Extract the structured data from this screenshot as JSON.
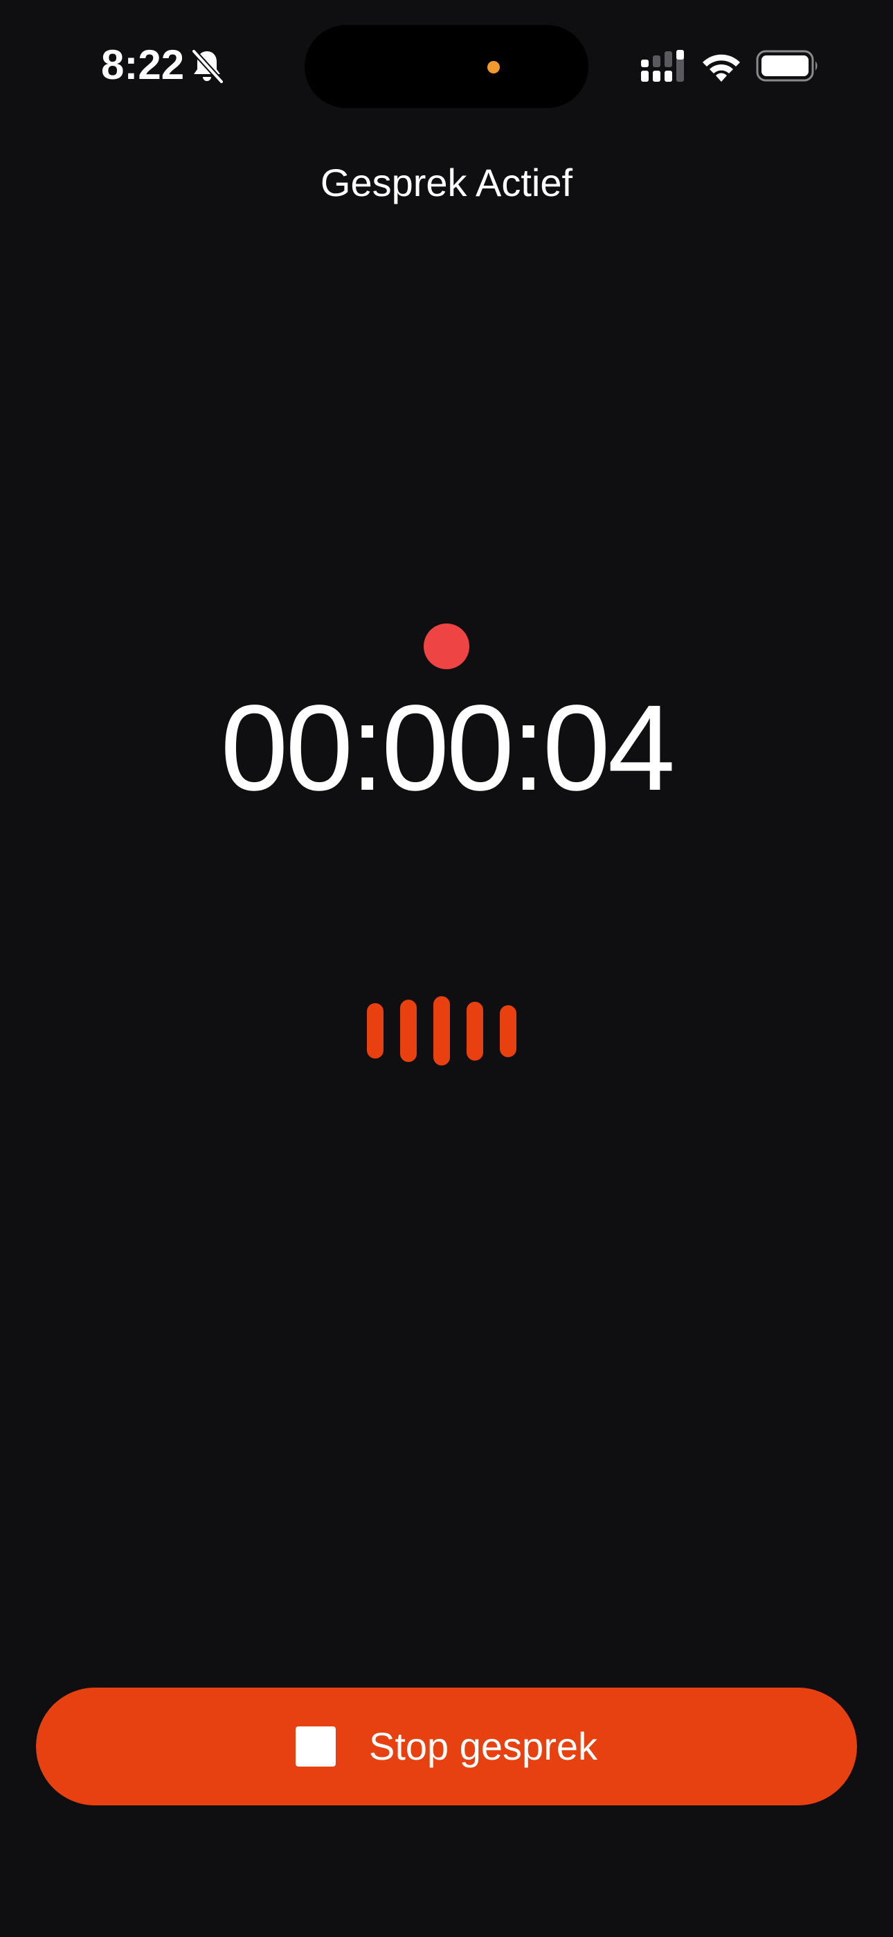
{
  "status_bar": {
    "time": "8:22",
    "icons": [
      "bell-slash-icon",
      "signal-icon",
      "wifi-icon",
      "battery-icon"
    ],
    "camera_indicator_color": "#f39a2f"
  },
  "header": {
    "title": "Gesprek Actief"
  },
  "recording": {
    "indicator_color": "#ef4444",
    "elapsed": "00:00:04"
  },
  "waveform": {
    "color": "#e8410f",
    "levels": [
      0.8,
      0.9,
      1.0,
      0.85,
      0.75
    ]
  },
  "actions": {
    "stop_label": "Stop gesprek",
    "stop_icon": "stop-icon",
    "accent_color": "#e84111"
  }
}
